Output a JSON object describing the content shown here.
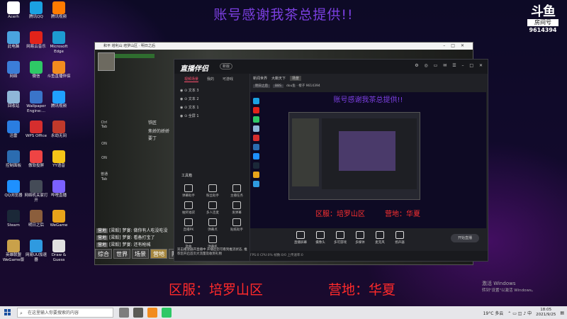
{
  "banner": {
    "top": "账号感谢我茶总提供!!",
    "server": "区服：培罗山区",
    "camp": "营地：华夏"
  },
  "room": {
    "logo": "斗鱼",
    "label": "房间号",
    "number": "9614394"
  },
  "desktop_icons": [
    {
      "name": "Acerh",
      "color": "#ffffff"
    },
    {
      "name": "腾讯QQ",
      "color": "#1ba1e2"
    },
    {
      "name": "腾讯视频",
      "color": "#ff7b00"
    },
    {
      "name": "此电脑",
      "color": "#4aa3df"
    },
    {
      "name": "网易云音乐",
      "color": "#e2231a"
    },
    {
      "name": "Microsoft Edge",
      "color": "#1d9bd1"
    },
    {
      "name": "网络",
      "color": "#3b7dd8"
    },
    {
      "name": "微信",
      "color": "#2ec866"
    },
    {
      "name": "斗鱼直播伴侣",
      "color": "#f28c1e"
    },
    {
      "name": "回收站",
      "color": "#8fb7d8"
    },
    {
      "name": "Wallpaper Engine:...",
      "color": "#3a74c9"
    },
    {
      "name": "腾讯视频",
      "color": "#20a0ff"
    },
    {
      "name": "迅雷",
      "color": "#2a7de1"
    },
    {
      "name": "WPS Office",
      "color": "#d62e2e"
    },
    {
      "name": "永劫无间",
      "color": "#c0392b"
    },
    {
      "name": "控制面板",
      "color": "#2b6cb0"
    },
    {
      "name": "傲软投屏",
      "color": "#ef4444"
    },
    {
      "name": "YY语音",
      "color": "#f5c518"
    },
    {
      "name": "QQ浏览器",
      "color": "#1e90ff"
    },
    {
      "name": "网络机关家打开",
      "color": "#444b57"
    },
    {
      "name": "哔哩直播",
      "color": "#7b61ff"
    },
    {
      "name": "Steam",
      "color": "#1b2838"
    },
    {
      "name": "明日之后",
      "color": "#8b5e3c"
    },
    {
      "name": "WeGame",
      "color": "#e8a31a"
    },
    {
      "name": "英雄联盟WeGame版",
      "color": "#c9a14a"
    },
    {
      "name": "网易UU加速器",
      "color": "#2f9ae0"
    },
    {
      "name": "Draw & Guess",
      "color": "#e0e0e0"
    }
  ],
  "game": {
    "title": "和平  塔利山   培罗山区 · 明日之后",
    "hints": [
      "铁匠",
      "焦娇的娇娇",
      "要丁"
    ],
    "side_labels": [
      "Ctrl Tab",
      "ON",
      "ON",
      "普通",
      "Tab"
    ],
    "chat": [
      {
        "tag": "营地",
        "text": "[梁毅] 梦宴: 做你有人吃没吃没"
      },
      {
        "tag": "营地",
        "text": "[梁毅] 梦宴: 看备打宝了"
      },
      {
        "tag": "营地",
        "text": "[梁毅] 梦宴: 还有枪械"
      }
    ],
    "chat_tabs": [
      "综合",
      "世界",
      "场景",
      "营地",
      "队伍"
    ],
    "active_chat_tab": "营地"
  },
  "obs": {
    "brand": "直播伴侣",
    "version": "新版",
    "left_tabs": [
      "视频场景",
      "我的",
      "可游戏"
    ],
    "sources": [
      "文本 3",
      "文本 2",
      "文本 1",
      "全屏 1"
    ],
    "toolbox_title": "工具箱",
    "tools": [
      "弹幕助手",
      "粉丝助手",
      "主播任务",
      "抽奖福袋",
      "多人连麦",
      "发弹幕",
      "直播PK",
      "弹幕点",
      "贴纸助手",
      "歌曲",
      "弹幕机"
    ],
    "scene_tabs": [
      "新闻世界",
      "大嘶天下",
      "场景"
    ],
    "sub_labels": [
      "明日之后",
      "BBS",
      "dou鱼 · 橙子",
      "9614394"
    ],
    "controls": [
      "直播屏幕",
      "摄像头",
      "多可游戏",
      "多媒体",
      "麦克风",
      "扬声器"
    ],
    "start": "开始直播",
    "notice": "双击播放器开直播中 开播后您可看到推流状态, 推荐您开启首页大流量及收到礼物",
    "status": "FPS:0  CPU:0%  帧数:0/0  上传速率:0"
  },
  "activate": {
    "line1": "激活 Windows",
    "line2": "转到\"设置\"以激活 Windows。"
  },
  "taskbar": {
    "search_placeholder": "在这里输入你要搜索的内容",
    "weather": "19°C 多云",
    "time": "18:05",
    "date": "2021/9/25"
  }
}
